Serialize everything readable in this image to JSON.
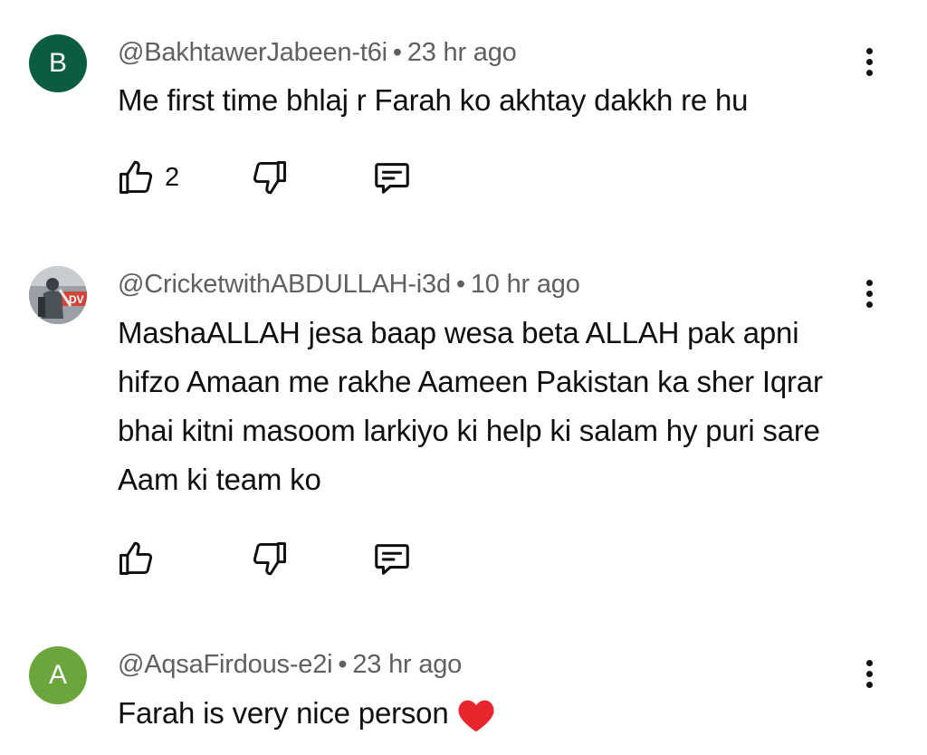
{
  "comments": [
    {
      "avatar_letter": "B",
      "avatar_color": "#0b5d3f",
      "handle": "@BakhtawerJabeen-t6i",
      "separator": "•",
      "time": "23 hr ago",
      "text": "Me first time bhlaj r Farah ko akhtay dakkh re hu",
      "likes": "2"
    },
    {
      "avatar_letter": "",
      "avatar_color": "#8a8f96",
      "handle": "@CricketwithABDULLAH-i3d",
      "separator": "•",
      "time": "10 hr ago",
      "text": "MashaALLAH jesa baap wesa beta ALLAH pak apni hifzo Amaan me rakhe Aameen Pakistan ka sher Iqrar bhai kitni masoom larkiyo ki help ki salam hy puri sare Aam ki team ko",
      "likes": ""
    },
    {
      "avatar_letter": "A",
      "avatar_color": "#6aa63b",
      "handle": "@AqsaFirdous-e2i",
      "separator": "•",
      "time": "23 hr ago",
      "text": "Farah is very nice person",
      "emoji": "red-heart-emoji",
      "likes": ""
    }
  ],
  "icons": {
    "like": "thumb-up-outline-icon",
    "dislike": "thumb-down-outline-icon",
    "reply": "comment-bubble-icon",
    "menu": "more-vert-icon"
  },
  "colors": {
    "text_primary": "#0f0f0f",
    "text_secondary": "#606060",
    "heart": "#e8262d"
  }
}
